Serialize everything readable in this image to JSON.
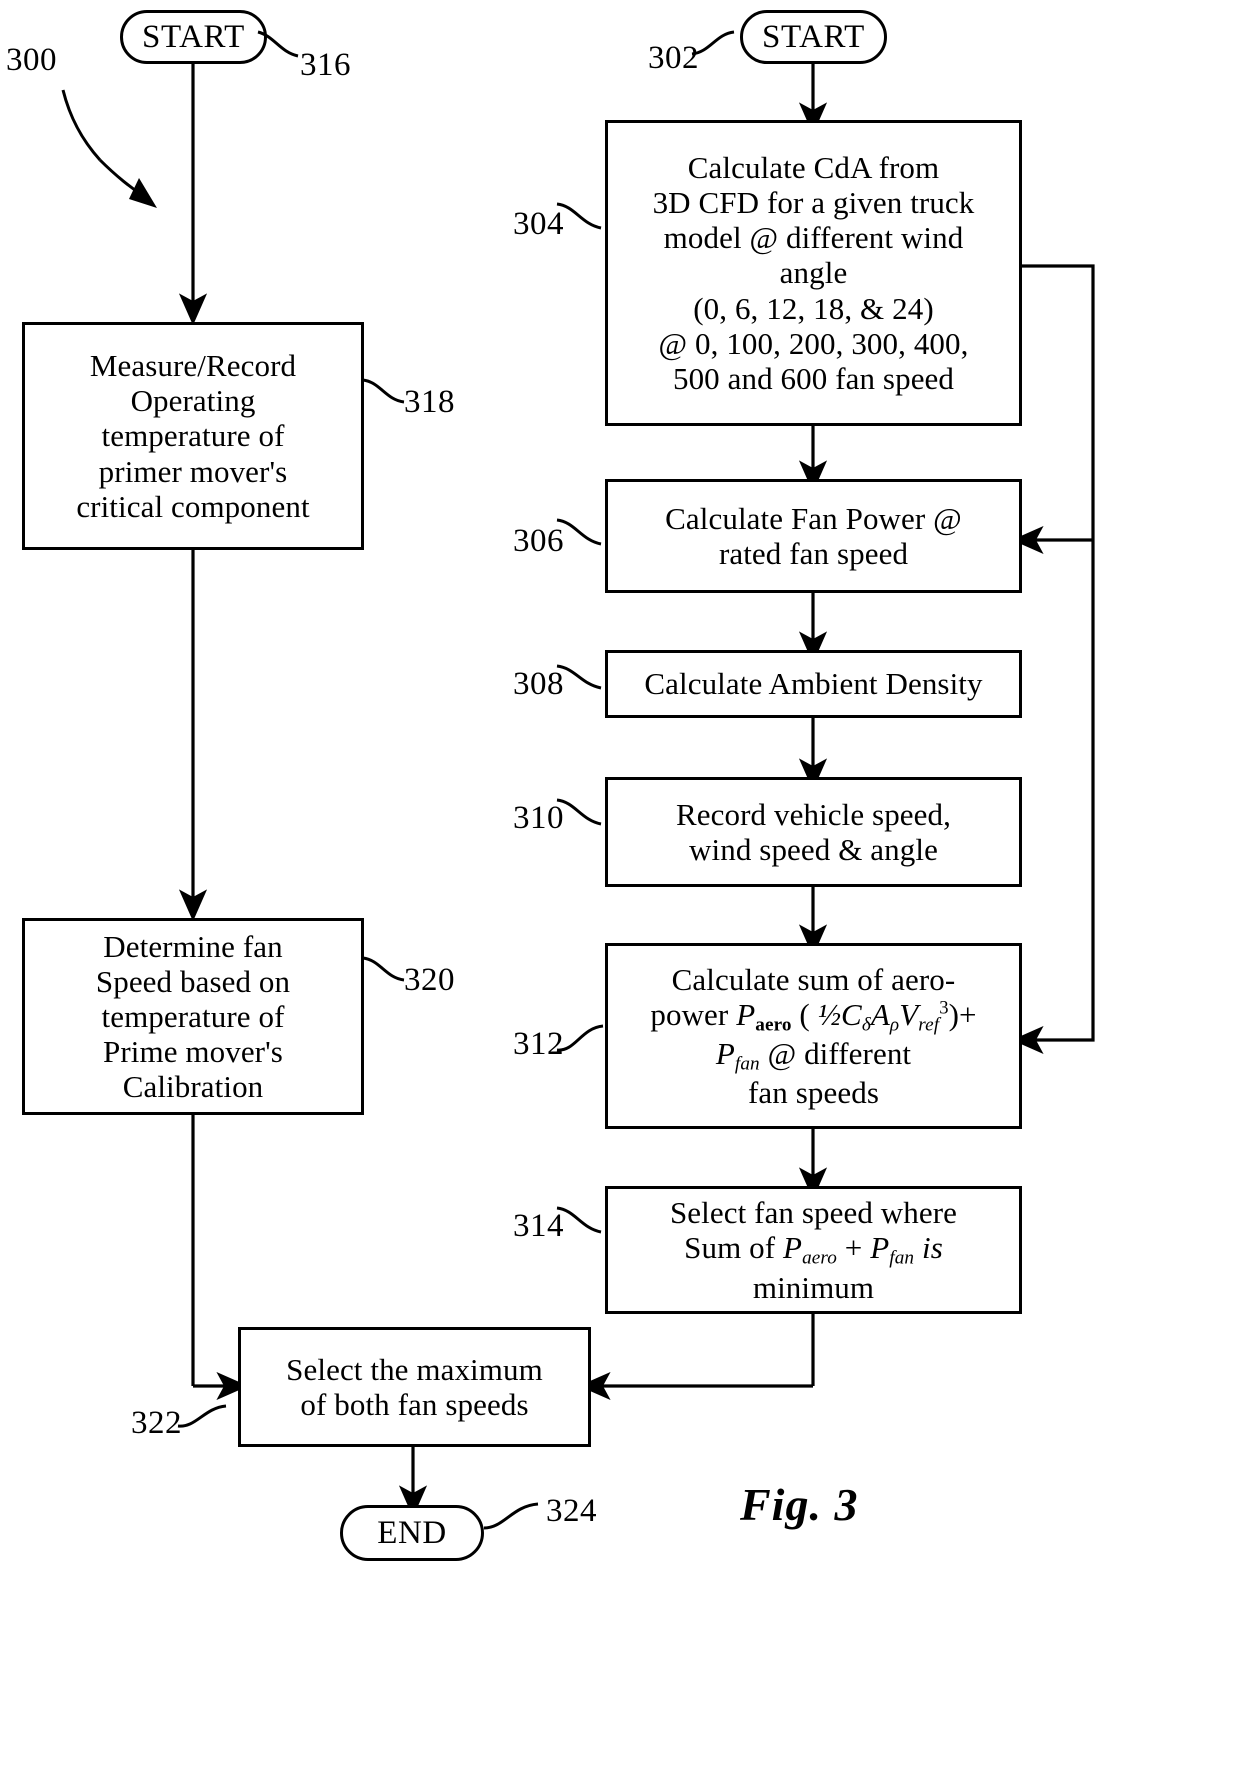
{
  "figure": {
    "label": "Fig. 3",
    "diagram_ref": "300"
  },
  "nodes": {
    "start_left": {
      "ref": "316",
      "label": "START",
      "shape": "terminal"
    },
    "box318": {
      "ref": "318",
      "lines": [
        "Measure/Record",
        "Operating",
        "temperature of",
        "primer mover's",
        "critical component"
      ]
    },
    "box320": {
      "ref": "320",
      "lines": [
        "Determine fan",
        "Speed based on",
        "temperature of",
        "Prime mover's",
        "Calibration"
      ]
    },
    "start_right": {
      "ref": "302",
      "label": "START",
      "shape": "terminal"
    },
    "box304": {
      "ref": "304",
      "lines": [
        "Calculate CdA from",
        "3D CFD for a given truck",
        "model @ different wind",
        "angle",
        "(0, 6, 12, 18, & 24)",
        "@ 0, 100, 200, 300, 400,",
        "500 and 600 fan speed"
      ]
    },
    "box306": {
      "ref": "306",
      "lines": [
        "Calculate Fan Power @",
        "rated fan speed"
      ]
    },
    "box308": {
      "ref": "308",
      "lines": [
        "Calculate Ambient Density"
      ]
    },
    "box310": {
      "ref": "310",
      "lines": [
        "Record vehicle speed,",
        "wind speed & angle"
      ]
    },
    "box312": {
      "ref": "312",
      "lines": [
        "Calculate sum of aero-",
        "power  P_aero ( ½ C_δ A_ρ V_ref ³)+",
        "P_fan @ different",
        "fan speeds"
      ],
      "formula_plain": "Paero (1/2 Cδ Aρ Vref 3) + Pfan"
    },
    "box314": {
      "ref": "314",
      "lines": [
        "Select fan speed where",
        "Sum of P_aero + P_fan  is",
        "minimum"
      ],
      "formula_plain": "Sum of Paero + Pfan is minimum"
    },
    "box322": {
      "ref": "322",
      "lines": [
        "Select the maximum",
        "of both fan speeds"
      ]
    },
    "end": {
      "ref": "324",
      "label": "END",
      "shape": "terminal"
    }
  },
  "text_fragments": {
    "b312_l1": "Calculate sum of aero-",
    "b312_l2_a": "power ",
    "b312_P": "P",
    "b312_aero": "aero",
    "b312_paren_open": " ( ",
    "b312_half": "½",
    "b312_C": "C",
    "b312_delta": "δ",
    "b312_A": "A",
    "b312_rho": "ρ",
    "b312_V": "V",
    "b312_ref": "ref",
    "b312_cube": "3",
    "b312_paren_close": ")+",
    "b312_l3_fan": "fan",
    "b312_l3_rest": " @ different",
    "b312_l4": "fan speeds",
    "b314_l1": "Select fan speed where",
    "b314_sum": "Sum of ",
    "b314_plus": " + ",
    "b314_is": " is",
    "b314_l3": "minimum"
  },
  "colors": {
    "stroke": "#000000",
    "background": "#ffffff"
  }
}
